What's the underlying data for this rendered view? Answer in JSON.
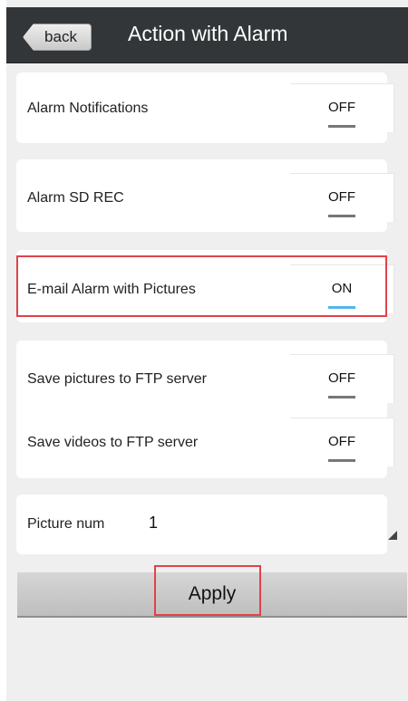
{
  "header": {
    "back_label": "back",
    "title": "Action with Alarm"
  },
  "settings": [
    {
      "label": "Alarm Notifications",
      "value": "OFF",
      "on": false
    },
    {
      "label": "Alarm SD REC",
      "value": "OFF",
      "on": false
    },
    {
      "label": "E-mail Alarm with Pictures",
      "value": "ON",
      "on": true
    },
    {
      "label": "Save pictures to FTP server",
      "value": "OFF",
      "on": false
    },
    {
      "label": "Save videos to FTP server",
      "value": "OFF",
      "on": false
    }
  ],
  "picture_num": {
    "label": "Picture num",
    "value": "1"
  },
  "apply_label": "Apply",
  "colors": {
    "header_bg": "#333638",
    "screen_bg": "#efefef",
    "toggle_on": "#52b6e8",
    "toggle_off": "#777777",
    "highlight": "#e0424a"
  }
}
